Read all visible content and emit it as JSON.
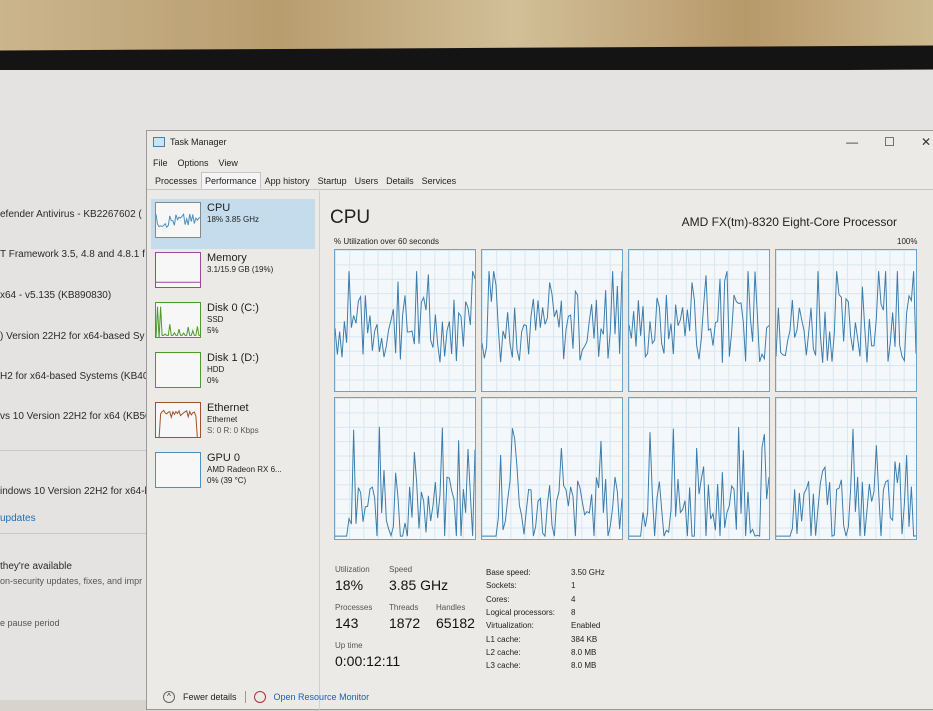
{
  "background_window": {
    "lines": [
      "efender Antivirus - KB2267602 (",
      "T Framework 3.5, 4.8 and 4.8.1 f",
      "x64 - v5.135 (KB890830)",
      ") Version 22H2 for x64-based Sy",
      "H2 for x64-based Systems (KB40",
      "vs 10 Version 22H2 for x64 (KB50",
      "indows 10 Version 22H2 for x64-b"
    ],
    "link": "updates",
    "section_title": "they're available",
    "section_desc": "on-security updates, fixes, and impr",
    "pause_text": "e pause period"
  },
  "window": {
    "title": "Task Manager",
    "controls": [
      "—",
      "☐",
      "✕"
    ]
  },
  "menu": [
    "File",
    "Options",
    "View"
  ],
  "tabs": [
    "Processes",
    "Performance",
    "App history",
    "Startup",
    "Users",
    "Details",
    "Services"
  ],
  "active_tab": "Performance",
  "sidebar": [
    {
      "name": "CPU",
      "sub1": "18% 3.85 GHz",
      "color": "#4a90c0"
    },
    {
      "name": "Memory",
      "sub1": "3.1/15.9 GB (19%)",
      "color": "#9b4a9b"
    },
    {
      "name": "Disk 0 (C:)",
      "sub1": "SSD",
      "sub2": "5%",
      "color": "#4d9a2a"
    },
    {
      "name": "Disk 1 (D:)",
      "sub1": "HDD",
      "sub2": "0%",
      "color": "#4d9a2a"
    },
    {
      "name": "Ethernet",
      "sub1": "Ethernet",
      "sub2": "S: 0 R: 0 Kbps",
      "color": "#a0522d"
    },
    {
      "name": "GPU 0",
      "sub1": "AMD Radeon RX 6...",
      "sub2": "0% (39 °C)",
      "color": "#4a90c0"
    }
  ],
  "main": {
    "title": "CPU",
    "processor": "AMD FX(tm)-8320 Eight-Core Processor",
    "util_label": "% Utilization over 60 seconds",
    "max_label": "100%",
    "line_color": "#3b7cab",
    "stats": {
      "utilization_label": "Utilization",
      "utilization": "18%",
      "speed_label": "Speed",
      "speed": "3.85 GHz",
      "processes_label": "Processes",
      "processes": "143",
      "threads_label": "Threads",
      "threads": "1872",
      "handles_label": "Handles",
      "handles": "65182",
      "uptime_label": "Up time",
      "uptime": "0:00:12:11"
    },
    "specs": [
      [
        "Base speed:",
        "3.50 GHz"
      ],
      [
        "Sockets:",
        "1"
      ],
      [
        "Cores:",
        "4"
      ],
      [
        "Logical processors:",
        "8"
      ],
      [
        "Virtualization:",
        "Enabled"
      ],
      [
        "L1 cache:",
        "384 KB"
      ],
      [
        "L2 cache:",
        "8.0 MB"
      ],
      [
        "L3 cache:",
        "8.0 MB"
      ]
    ]
  },
  "footer": {
    "fewer": "Fewer details",
    "monitor": "Open Resource Monitor"
  }
}
